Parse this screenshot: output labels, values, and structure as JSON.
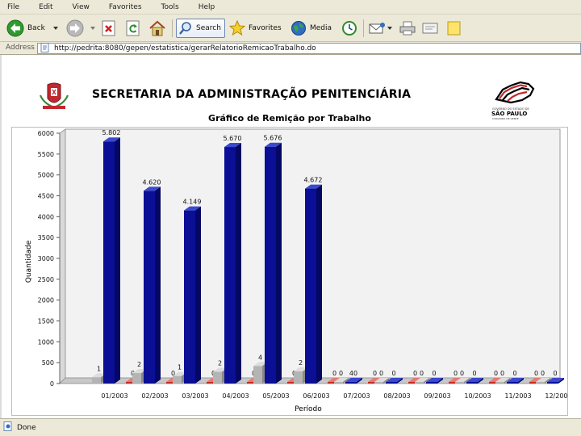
{
  "menu": [
    "File",
    "Edit",
    "View",
    "Favorites",
    "Tools",
    "Help"
  ],
  "toolbar": {
    "back_label": "Back",
    "search_label": "Search",
    "favorites_label": "Favorites",
    "media_label": "Media"
  },
  "address": {
    "label": "Address",
    "url": "http://pedrita:8080/gepen/estatistica/gerarRelatorioRemicaoTrabalho.do"
  },
  "header": {
    "title": "SECRETARIA DA ADMINISTRAÇÃO PENITENCIÁRIA",
    "gov_line1": "GOVERNO DO ESTADO DE",
    "gov_name": "SÃO PAULO",
    "gov_line2": "CUIDANDO DE GENTE"
  },
  "status": {
    "text": "Done"
  },
  "colors": {
    "chrome": "#ece9d8",
    "plot_background": "#f2f2f2",
    "series_main": "#0a0f96",
    "series_gray": "#b4b4b4",
    "series_red": "#cc2a22"
  },
  "chart_data": {
    "type": "bar",
    "title": "Gráfico de Remição por Trabalho",
    "xlabel": "Período",
    "ylabel": "Quantidade",
    "ylim": [
      0,
      6000
    ],
    "yticks": [
      0,
      500,
      1000,
      1500,
      2000,
      2500,
      3000,
      3500,
      4000,
      4500,
      5000,
      5500,
      6000
    ],
    "grid": false,
    "categories": [
      "01/2003",
      "02/2003",
      "03/2003",
      "04/2003",
      "05/2003",
      "06/2003",
      "07/2003",
      "08/2003",
      "09/2003",
      "10/2003",
      "11/2003",
      "12/2003"
    ],
    "series": [
      {
        "values": [
          150,
          250,
          180,
          280,
          420,
          290,
          0,
          0,
          0,
          0,
          0,
          0
        ],
        "labels": [
          "1",
          "2",
          "1",
          "2",
          "4",
          "2",
          "0",
          "0",
          "0",
          "0",
          "0",
          "0"
        ]
      },
      {
        "values": [
          5802,
          4620,
          4149,
          5670,
          5676,
          4672,
          40,
          0,
          0,
          0,
          0,
          0
        ],
        "labels": [
          "5.802",
          "4.620",
          "4.149",
          "5.670",
          "5.676",
          "4.672",
          "40",
          "0",
          "0",
          "0",
          "0",
          "0"
        ]
      },
      {
        "values": [
          0,
          0,
          0,
          0,
          0,
          0,
          0,
          0,
          0,
          0,
          0,
          0
        ],
        "labels": [
          "0",
          "0",
          "0",
          "0",
          "0",
          "0",
          "0",
          "0",
          "0",
          "0",
          "0",
          "0"
        ]
      }
    ]
  }
}
